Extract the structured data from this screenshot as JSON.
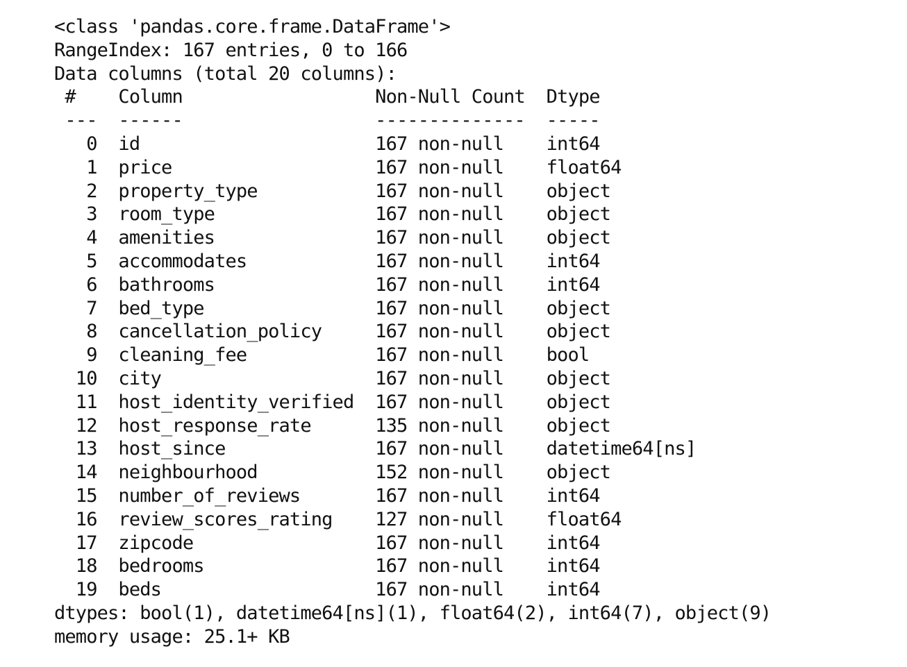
{
  "output": {
    "kind": "pandas-dataframe-info",
    "header_class_line": "<class 'pandas.core.frame.DataFrame'>",
    "range_index_line": "RangeIndex: 167 entries, 0 to 166",
    "data_columns_line": "Data columns (total 20 columns):",
    "column_header": {
      "index_label": "#",
      "column_label": "Column",
      "non_null_label": "Non-Null Count",
      "dtype_label": "Dtype"
    },
    "separator_row": {
      "index_rule": "---",
      "column_rule": "------",
      "non_null_rule": "--------------",
      "dtype_rule": "-----"
    },
    "entries": 167,
    "index_start": 0,
    "index_end": 166,
    "total_columns": 20,
    "rows": [
      {
        "index": "0",
        "column": "id",
        "non_null": "167 non-null",
        "dtype": "int64"
      },
      {
        "index": "1",
        "column": "price",
        "non_null": "167 non-null",
        "dtype": "float64"
      },
      {
        "index": "2",
        "column": "property_type",
        "non_null": "167 non-null",
        "dtype": "object"
      },
      {
        "index": "3",
        "column": "room_type",
        "non_null": "167 non-null",
        "dtype": "object"
      },
      {
        "index": "4",
        "column": "amenities",
        "non_null": "167 non-null",
        "dtype": "object"
      },
      {
        "index": "5",
        "column": "accommodates",
        "non_null": "167 non-null",
        "dtype": "int64"
      },
      {
        "index": "6",
        "column": "bathrooms",
        "non_null": "167 non-null",
        "dtype": "int64"
      },
      {
        "index": "7",
        "column": "bed_type",
        "non_null": "167 non-null",
        "dtype": "object"
      },
      {
        "index": "8",
        "column": "cancellation_policy",
        "non_null": "167 non-null",
        "dtype": "object"
      },
      {
        "index": "9",
        "column": "cleaning_fee",
        "non_null": "167 non-null",
        "dtype": "bool"
      },
      {
        "index": "10",
        "column": "city",
        "non_null": "167 non-null",
        "dtype": "object"
      },
      {
        "index": "11",
        "column": "host_identity_verified",
        "non_null": "167 non-null",
        "dtype": "object"
      },
      {
        "index": "12",
        "column": "host_response_rate",
        "non_null": "135 non-null",
        "dtype": "object"
      },
      {
        "index": "13",
        "column": "host_since",
        "non_null": "167 non-null",
        "dtype": "datetime64[ns]"
      },
      {
        "index": "14",
        "column": "neighbourhood",
        "non_null": "152 non-null",
        "dtype": "object"
      },
      {
        "index": "15",
        "column": "number_of_reviews",
        "non_null": "167 non-null",
        "dtype": "int64"
      },
      {
        "index": "16",
        "column": "review_scores_rating",
        "non_null": "127 non-null",
        "dtype": "float64"
      },
      {
        "index": "17",
        "column": "zipcode",
        "non_null": "167 non-null",
        "dtype": "int64"
      },
      {
        "index": "18",
        "column": "bedrooms",
        "non_null": "167 non-null",
        "dtype": "int64"
      },
      {
        "index": "19",
        "column": "beds",
        "non_null": "167 non-null",
        "dtype": "int64"
      }
    ],
    "dtypes_line": "dtypes: bool(1), datetime64[ns](1), float64(2), int64(7), object(9)",
    "memory_usage_line": "memory usage: 25.1+ KB",
    "dtype_summary": [
      {
        "name": "bool",
        "count": 1
      },
      {
        "name": "datetime64[ns]",
        "count": 1
      },
      {
        "name": "float64",
        "count": 2
      },
      {
        "name": "int64",
        "count": 7
      },
      {
        "name": "object",
        "count": 9
      }
    ],
    "memory_usage": "25.1+ KB",
    "colors": {
      "background": "#ffffff",
      "text": "#111111"
    }
  }
}
